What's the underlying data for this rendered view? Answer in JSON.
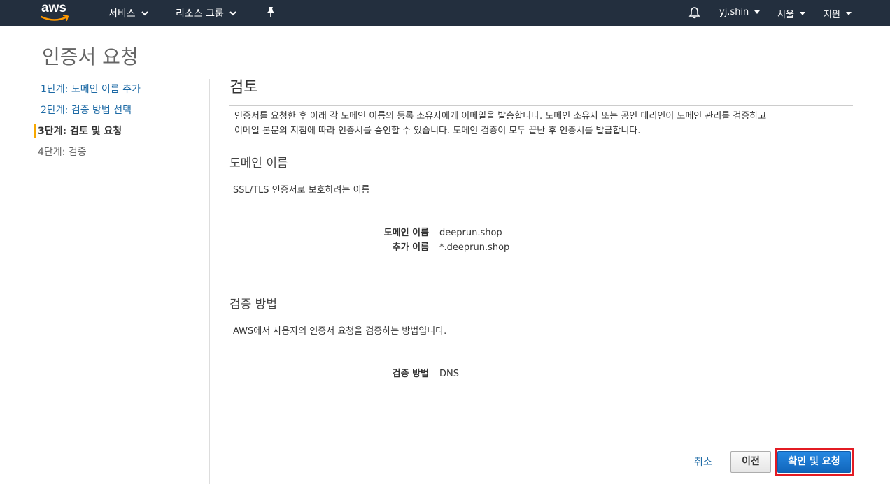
{
  "nav": {
    "logo": "aws",
    "services": "서비스",
    "resource_groups": "리소스 그룹",
    "pin_icon": "pin-icon",
    "bell_icon": "bell-icon",
    "user": "yj.shin",
    "region": "서울",
    "support": "지원"
  },
  "page": {
    "title": "인증서 요청"
  },
  "steps": [
    {
      "label": "1단계: 도메인 이름 추가",
      "state": "link"
    },
    {
      "label": "2단계: 검증 방법 선택",
      "state": "link"
    },
    {
      "label": "3단계: 검토 및 요청",
      "state": "active"
    },
    {
      "label": "4단계: 검증",
      "state": "inactive"
    }
  ],
  "review": {
    "heading": "검토",
    "description_line1": "인증서를 요청한 후 아래 각 도메인 이름의 등록 소유자에게 이메일을 발송합니다. 도메인 소유자 또는 공인 대리인이 도메인 관리를 검증하고",
    "description_line2": "이메일 본문의 지침에 따라 인증서를 승인할 수 있습니다. 도메인 검증이 모두 끝난 후 인증서를 발급합니다."
  },
  "domain_section": {
    "heading": "도메인 이름",
    "description": "SSL/TLS 인증서로 보호하려는 이름",
    "domain_name_label": "도메인 이름",
    "domain_name_value": "deeprun.shop",
    "additional_names_label": "추가 이름",
    "additional_names_value": "*.deeprun.shop"
  },
  "validation_section": {
    "heading": "검증 방법",
    "description": "AWS에서 사용자의 인증서 요청을 검증하는 방법입니다.",
    "method_label": "검증 방법",
    "method_value": "DNS"
  },
  "footer": {
    "cancel": "취소",
    "previous": "이전",
    "confirm": "확인 및 요청"
  },
  "colors": {
    "nav_bg": "#232f3e",
    "link": "#1d6aa5",
    "active_marker": "#f7a800",
    "primary_button": "#1a75d2",
    "highlight_outline": "#e31b23"
  }
}
